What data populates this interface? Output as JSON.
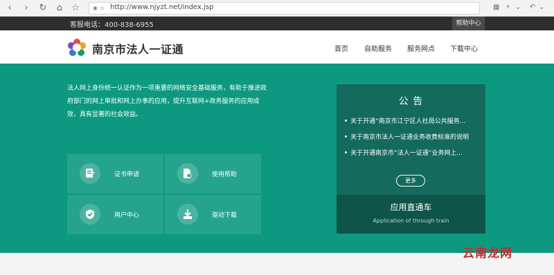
{
  "browser": {
    "url": "http://www.njyzt.net/index.jsp"
  },
  "topbar": {
    "hotline": "客服电话：400-838-6955",
    "help": "帮助中心"
  },
  "header": {
    "logo_text": "南京市法人一证通",
    "nav": [
      "首页",
      "自助服务",
      "服务网点",
      "下载中心"
    ]
  },
  "hero": {
    "intro": "法人网上身份统一认证作为一项重要的网络安全基础服务，有助于推进政府部门的网上审批和网上办事的应用，提升互联网+政务服务的应用成效，具有显著的社会效益。"
  },
  "tiles": [
    {
      "label": "证书申请",
      "icon": "certificate-apply-icon"
    },
    {
      "label": "使用帮助",
      "icon": "help-doc-icon"
    },
    {
      "label": "用户中心",
      "icon": "user-center-icon"
    },
    {
      "label": "驱动下载",
      "icon": "download-icon"
    }
  ],
  "notice": {
    "title": "公  告",
    "items": [
      "关于开通“南京市江宁区人社局公共服务...",
      "关于南京市法人一证通业务收费标准的说明",
      "关于开通南京市“法人一证通”业务网上..."
    ],
    "more": "更多"
  },
  "app": {
    "title": "应用直通车",
    "subtitle": "Application of through train"
  },
  "watermark": "云南龙网",
  "colors": {
    "primary": "#0d9980",
    "notice_bg": "#136a5d",
    "app_bg": "#0e5448",
    "topbar": "#2e2e2e"
  }
}
